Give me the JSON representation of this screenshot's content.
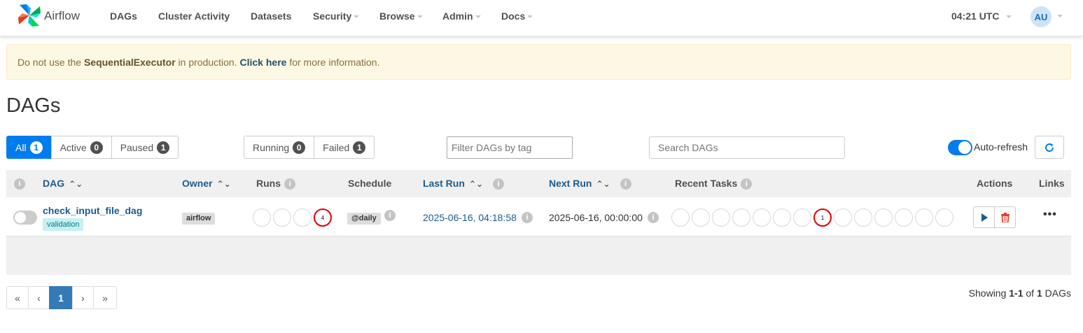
{
  "nav": {
    "brand": "Airflow",
    "items": [
      {
        "label": "DAGs",
        "caret": false
      },
      {
        "label": "Cluster Activity",
        "caret": false
      },
      {
        "label": "Datasets",
        "caret": false
      },
      {
        "label": "Security",
        "caret": true
      },
      {
        "label": "Browse",
        "caret": true
      },
      {
        "label": "Admin",
        "caret": true
      },
      {
        "label": "Docs",
        "caret": true
      }
    ],
    "clock": "04:21 UTC",
    "user_initials": "AU"
  },
  "alert": {
    "prefix": "Do not use the ",
    "executor": "SequentialExecutor",
    "middle": " in production. ",
    "link": "Click here",
    "suffix": " for more information."
  },
  "page_title": "DAGs",
  "status_filters": [
    {
      "label": "All",
      "count": "1",
      "active": true
    },
    {
      "label": "Active",
      "count": "0",
      "active": false
    },
    {
      "label": "Paused",
      "count": "1",
      "active": false
    }
  ],
  "run_filters": [
    {
      "label": "Running",
      "count": "0"
    },
    {
      "label": "Failed",
      "count": "1"
    }
  ],
  "tag_filter_placeholder": "Filter DAGs by tag",
  "search_placeholder": "Search DAGs",
  "auto_refresh_label": "Auto-refresh",
  "table": {
    "headers": {
      "dag": "DAG",
      "owner": "Owner",
      "runs": "Runs",
      "schedule": "Schedule",
      "last_run": "Last Run",
      "next_run": "Next Run",
      "recent_tasks": "Recent Tasks",
      "actions": "Actions",
      "links": "Links"
    },
    "rows": [
      {
        "dag_id": "check_input_file_dag",
        "tag": "validation",
        "owner": "airflow",
        "runs": [
          "",
          "",
          "",
          "4"
        ],
        "schedule": "@daily",
        "last_run": "2025-06-16, 04:18:58",
        "next_run": "2025-06-16, 00:00:00",
        "recent_tasks": [
          "",
          "",
          "",
          "",
          "",
          "",
          "",
          "1",
          "",
          "",
          "",
          "",
          "",
          ""
        ]
      }
    ]
  },
  "pagination": {
    "first": "«",
    "prev": "‹",
    "current": "1",
    "next": "›",
    "last": "»"
  },
  "showing": {
    "prefix": "Showing ",
    "range": "1-1",
    "middle": " of ",
    "total": "1",
    "suffix": " DAGs"
  }
}
